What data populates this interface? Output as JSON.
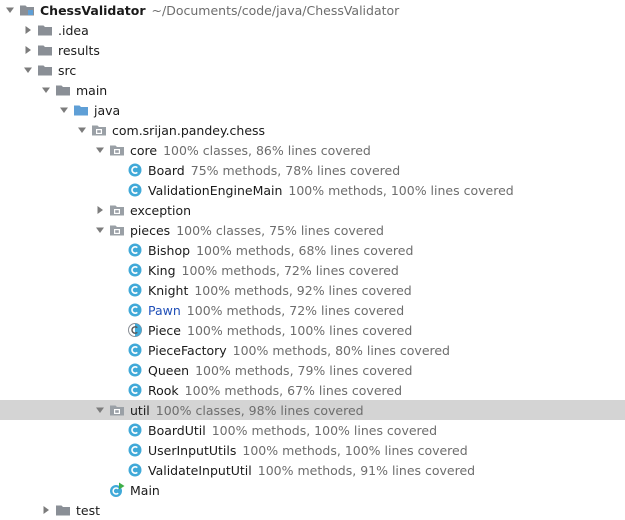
{
  "tree": {
    "root": {
      "name": "ChessValidator",
      "path": "~/Documents/code/java/ChessValidator"
    },
    "idea": {
      "name": ".idea"
    },
    "results": {
      "name": "results"
    },
    "src": {
      "name": "src"
    },
    "main": {
      "name": "main"
    },
    "java": {
      "name": "java"
    },
    "pkg": {
      "name": "com.srijan.pandey.chess"
    },
    "core": {
      "name": "core",
      "coverage": "100% classes, 86% lines covered"
    },
    "board": {
      "name": "Board",
      "coverage": "75% methods, 78% lines covered"
    },
    "validation_engine": {
      "name": "ValidationEngineMain",
      "coverage": "100% methods, 100% lines covered"
    },
    "exception": {
      "name": "exception"
    },
    "pieces": {
      "name": "pieces",
      "coverage": "100% classes, 75% lines covered"
    },
    "bishop": {
      "name": "Bishop",
      "coverage": "100% methods, 68% lines covered"
    },
    "king": {
      "name": "King",
      "coverage": "100% methods, 72% lines covered"
    },
    "knight": {
      "name": "Knight",
      "coverage": "100% methods, 92% lines covered"
    },
    "pawn": {
      "name": "Pawn",
      "coverage": "100% methods, 72% lines covered"
    },
    "piece": {
      "name": "Piece",
      "coverage": "100% methods, 100% lines covered"
    },
    "piece_factory": {
      "name": "PieceFactory",
      "coverage": "100% methods, 80% lines covered"
    },
    "queen": {
      "name": "Queen",
      "coverage": "100% methods, 79% lines covered"
    },
    "rook": {
      "name": "Rook",
      "coverage": "100% methods, 67% lines covered"
    },
    "util": {
      "name": "util",
      "coverage": "100% classes, 98% lines covered"
    },
    "board_util": {
      "name": "BoardUtil",
      "coverage": "100% methods, 100% lines covered"
    },
    "user_input_utils": {
      "name": "UserInputUtils",
      "coverage": "100% methods, 100% lines covered"
    },
    "validate_input_util": {
      "name": "ValidateInputUtil",
      "coverage": "100% methods, 91% lines covered"
    },
    "main_class": {
      "name": "Main"
    },
    "test": {
      "name": "test"
    }
  },
  "colors": {
    "folder": "#8a8f96",
    "class_icon": "#40a9d8",
    "pawn_text": "#2150b8",
    "selection": "#d4d4d4",
    "info_text": "#6d6d6d",
    "run_badge": "#3fae49"
  }
}
